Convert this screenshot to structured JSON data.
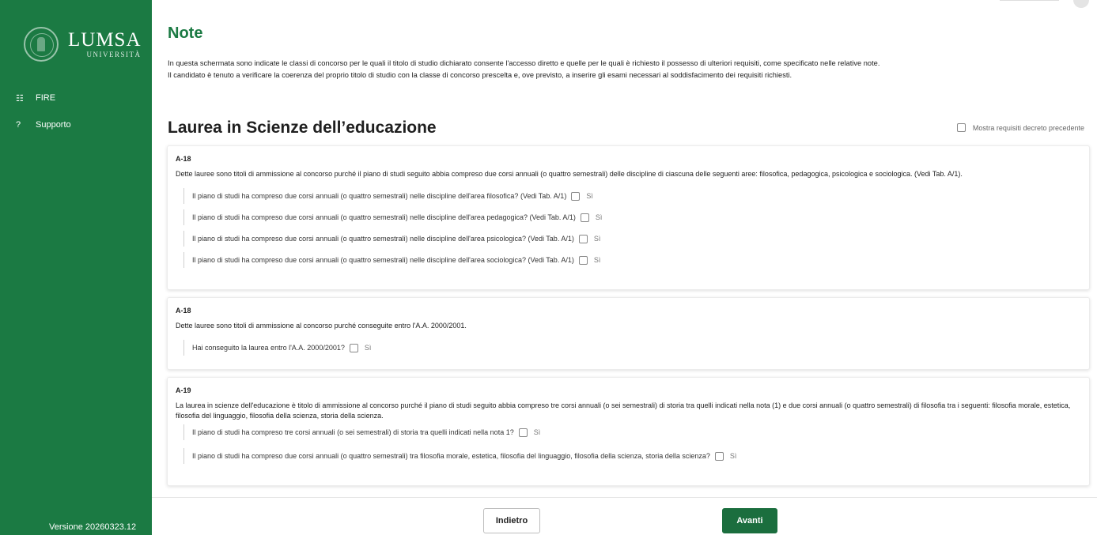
{
  "sidebar": {
    "brand_name": "LUMSA",
    "brand_sub": "UNIVERSITÀ",
    "items": [
      {
        "icon": "☷",
        "icon_name": "list-icon",
        "label": "FIRE"
      },
      {
        "icon": "?",
        "icon_name": "help-icon",
        "label": "Supporto"
      }
    ],
    "version": "Versione 20260323.12"
  },
  "note": {
    "title": "Note",
    "line1": "In questa schermata sono indicate le classi di concorso per le quali il titolo di studio dichiarato consente l'accesso diretto e quelle per le quali è richiesto il possesso di ulteriori requisiti, come specificato nelle relative note.",
    "line2": "Il candidato è tenuto a verificare la coerenza del proprio titolo di studio con la classe di concorso prescelta e, ove previsto, a inserire gli esami necessari al soddisfacimento dei requisiti richiesti."
  },
  "section": {
    "title": "Laurea in Scienze dell’educazione",
    "toggle_label": "Mostra requisiti decreto precedente"
  },
  "cards": [
    {
      "code": "A-18",
      "description": "Dette lauree sono titoli di ammissione al concorso purché il piano di studi seguito abbia compreso due corsi annuali (o quattro semestrali) delle discipline di ciascuna delle seguenti aree: filosofica, pedagogica, psicologica e sociologica. (Vedi Tab. A/1).",
      "questions": [
        "Il piano di studi ha compreso due corsi annuali (o quattro semestrali) nelle discipline dell'area filosofica? (Vedi Tab. A/1)",
        "Il piano di studi ha compreso due corsi annuali (o quattro semestrali) nelle discipline dell'area pedagogica? (Vedi Tab. A/1)",
        "Il piano di studi ha compreso due corsi annuali (o quattro semestrali) nelle discipline dell'area psicologica? (Vedi Tab. A/1)",
        "Il piano di studi ha compreso due corsi annuali (o quattro semestrali) nelle discipline dell'area sociologica? (Vedi Tab. A/1)"
      ]
    },
    {
      "code": "A-18",
      "description": "Dette lauree sono titoli di ammissione al concorso purché conseguite entro l'A.A. 2000/2001.",
      "questions": [
        "Hai conseguito la laurea entro l'A.A. 2000/2001?"
      ]
    },
    {
      "code": "A-19",
      "description": "La laurea in scienze dell'educazione è titolo di ammissione al concorso purché il piano di studi seguito abbia compreso tre corsi annuali (o sei semestrali) di storia tra quelli indicati nella nota (1) e due corsi annuali (o quattro semestrali) di filosofia tra i seguenti: filosofia morale, estetica, filosofia del linguaggio, filosofia della scienza, storia della scienza.",
      "questions": [
        "Il piano di studi ha compreso tre corsi annuali (o sei semestrali) di storia tra quelli indicati nella nota 1?",
        "Il piano di studi ha compreso due corsi annuali (o quattro semestrali) tra filosofia morale, estetica, filosofia del linguaggio, filosofia della scienza, storia della scienza?"
      ]
    }
  ],
  "answer_label": "Sì",
  "footer": {
    "back_label": "Indietro",
    "next_label": "Avanti"
  },
  "colors": {
    "brand_green": "#1b7a43",
    "button_green": "#1b6e3e"
  }
}
